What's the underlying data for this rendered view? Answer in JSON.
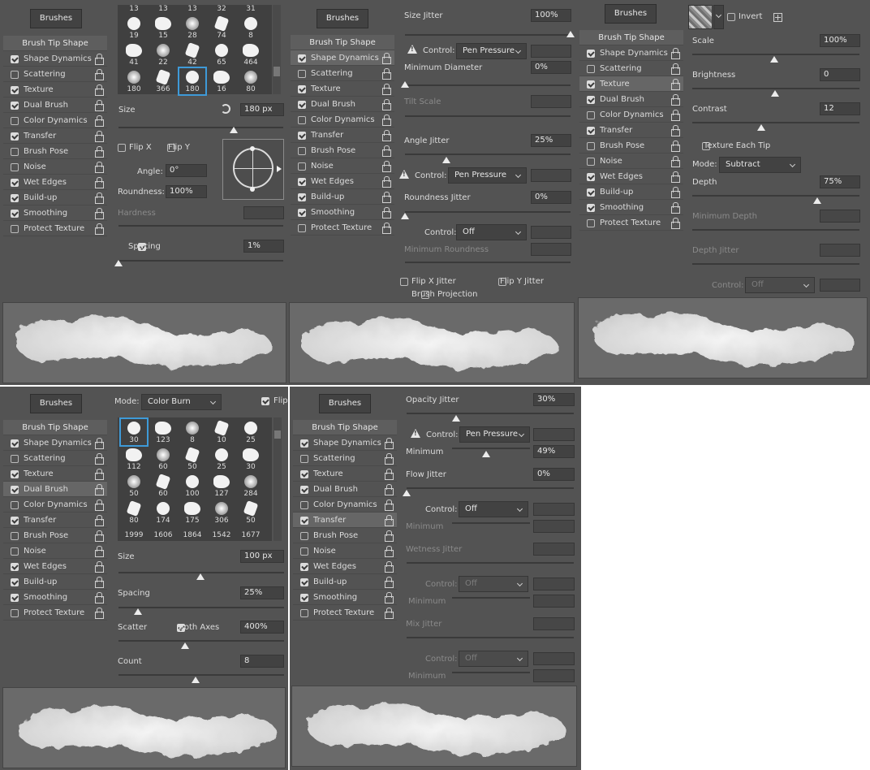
{
  "common": {
    "brushes_button": "Brushes",
    "brush_tip_shape": "Brush Tip Shape",
    "items": [
      "Shape Dynamics",
      "Scattering",
      "Texture",
      "Dual Brush",
      "Color Dynamics",
      "Transfer",
      "Brush Pose",
      "Noise",
      "Wet Edges",
      "Build-up",
      "Smoothing",
      "Protect Texture"
    ]
  },
  "panel1": {
    "checks": [
      true,
      false,
      true,
      true,
      false,
      true,
      false,
      false,
      true,
      true,
      true,
      false
    ],
    "grid_top_numbers": [
      "13",
      "13",
      "13",
      "32",
      "31"
    ],
    "grid_rows": [
      [
        "19",
        "15",
        "28",
        "74",
        "8"
      ],
      [
        "41",
        "22",
        "42",
        "65",
        "464"
      ],
      [
        "180",
        "366",
        "180",
        "16",
        "80"
      ]
    ],
    "size_label": "Size",
    "size_value": "180 px",
    "flip_x": "Flip X",
    "flip_y": "Flip Y",
    "angle_label": "Angle:",
    "angle_value": "0°",
    "roundness_label": "Roundness:",
    "roundness_value": "100%",
    "hardness_label": "Hardness",
    "spacing_label": "Spacing",
    "spacing_value": "1%"
  },
  "panel2": {
    "checks": [
      true,
      false,
      true,
      true,
      false,
      true,
      false,
      false,
      true,
      true,
      true,
      false
    ],
    "size_jitter_label": "Size Jitter",
    "size_jitter_value": "100%",
    "control_label": "Control:",
    "control_value": "Pen Pressure",
    "min_diameter_label": "Minimum Diameter",
    "min_diameter_value": "0%",
    "tilt_scale_label": "Tilt Scale",
    "angle_jitter_label": "Angle Jitter",
    "angle_jitter_value": "25%",
    "control2_value": "Pen Pressure",
    "roundness_jitter_label": "Roundness Jitter",
    "roundness_jitter_value": "0%",
    "control3_value": "Off",
    "min_roundness_label": "Minimum Roundness",
    "flip_x_jitter": "Flip X Jitter",
    "flip_y_jitter": "Flip Y Jitter",
    "brush_projection": "Brush Projection"
  },
  "panel3": {
    "checks": [
      true,
      false,
      true,
      true,
      false,
      true,
      false,
      false,
      true,
      true,
      true,
      false
    ],
    "invert_label": "Invert",
    "scale_label": "Scale",
    "scale_value": "100%",
    "brightness_label": "Brightness",
    "brightness_value": "0",
    "contrast_label": "Contrast",
    "contrast_value": "12",
    "texture_each_tip": "Texture Each Tip",
    "mode_label": "Mode:",
    "mode_value": "Subtract",
    "depth_label": "Depth",
    "depth_value": "75%",
    "min_depth_label": "Minimum Depth",
    "depth_jitter_label": "Depth Jitter",
    "control_label": "Control:",
    "control_value": "Off"
  },
  "panel4": {
    "checks": [
      true,
      false,
      true,
      true,
      false,
      true,
      false,
      false,
      true,
      true,
      true,
      false
    ],
    "mode_label": "Mode:",
    "mode_value": "Color Burn",
    "flip_label": "Flip",
    "grid_rows": [
      [
        "30",
        "123",
        "8",
        "10",
        "25"
      ],
      [
        "112",
        "60",
        "50",
        "25",
        "30"
      ],
      [
        "50",
        "60",
        "100",
        "127",
        "284"
      ],
      [
        "80",
        "174",
        "175",
        "306",
        "50"
      ]
    ],
    "grid_bottom_numbers": [
      "1999",
      "1606",
      "1864",
      "1542",
      "1677"
    ],
    "size_label": "Size",
    "size_value": "100 px",
    "spacing_label": "Spacing",
    "spacing_value": "25%",
    "scatter_label": "Scatter",
    "both_axes": "Both Axes",
    "scatter_value": "400%",
    "count_label": "Count",
    "count_value": "8"
  },
  "panel5": {
    "checks": [
      true,
      false,
      true,
      true,
      false,
      true,
      false,
      false,
      true,
      true,
      true,
      false
    ],
    "opacity_jitter_label": "Opacity Jitter",
    "opacity_jitter_value": "30%",
    "control_label": "Control:",
    "control_value": "Pen Pressure",
    "minimum_label": "Minimum",
    "minimum_value": "49%",
    "flow_jitter_label": "Flow Jitter",
    "flow_jitter_value": "0%",
    "control2_value": "Off",
    "minimum2_label": "Minimum",
    "wetness_jitter_label": "Wetness Jitter",
    "control3_value": "Off",
    "minimum3_label": "Minimum",
    "mix_jitter_label": "Mix Jitter",
    "control4_value": "Off",
    "minimum4_label": "Minimum"
  }
}
